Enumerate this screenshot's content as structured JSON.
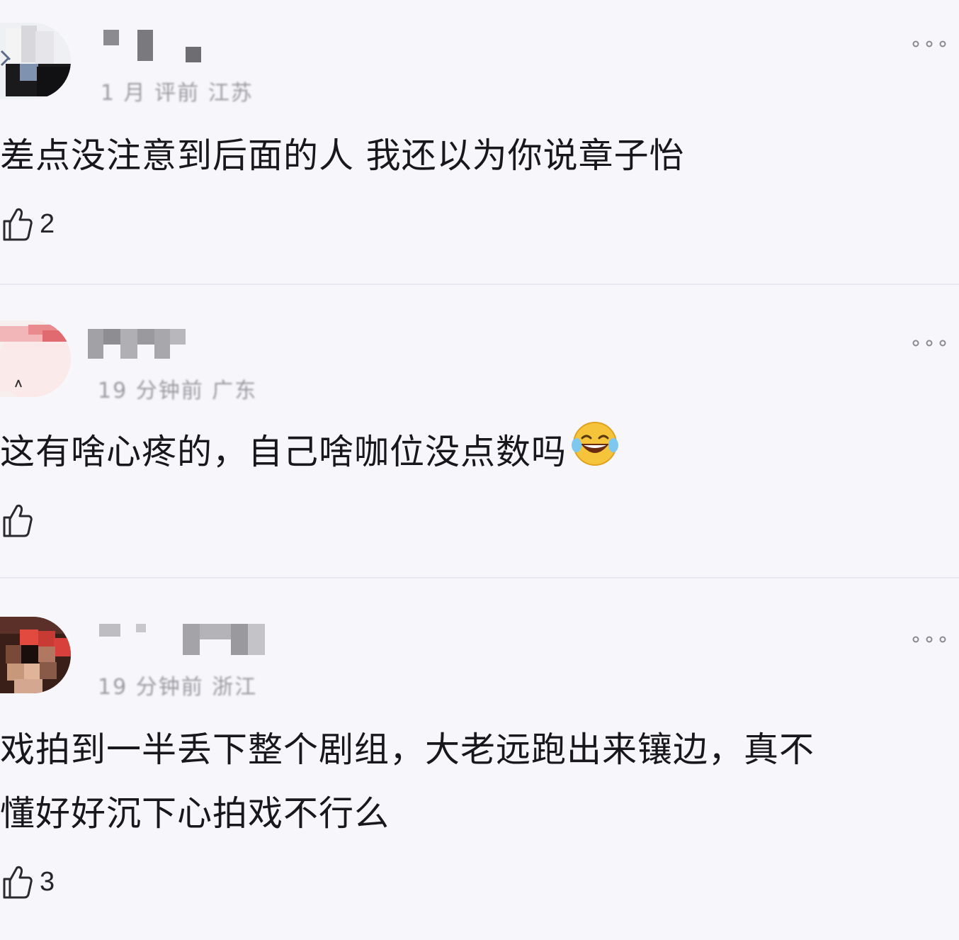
{
  "comments": [
    {
      "meta": "1 月 评前 江苏",
      "text": "差点没注意到后面的人 我还以为你说章子怡",
      "likes": "2",
      "more_icon": "more-dots-icon"
    },
    {
      "meta": "19 分钟前 广东",
      "text": "这有啥心疼的，自己啥咖位没点数吗",
      "emoji": "laugh-cry-emoji",
      "likes": "",
      "more_icon": "more-dots-icon"
    },
    {
      "meta": "19 分钟前 浙江",
      "text_line1": "戏拍到一半丢下整个剧组，大老远跑出来镶边，真不",
      "text_line2": "懂好好沉下心拍戏不行么",
      "likes": "3",
      "more_icon": "more-dots-icon"
    }
  ],
  "colors": {
    "background": "#f7f7fb",
    "text": "#18181c",
    "meta": "#9a9aa0",
    "divider": "#e7e8f0"
  }
}
